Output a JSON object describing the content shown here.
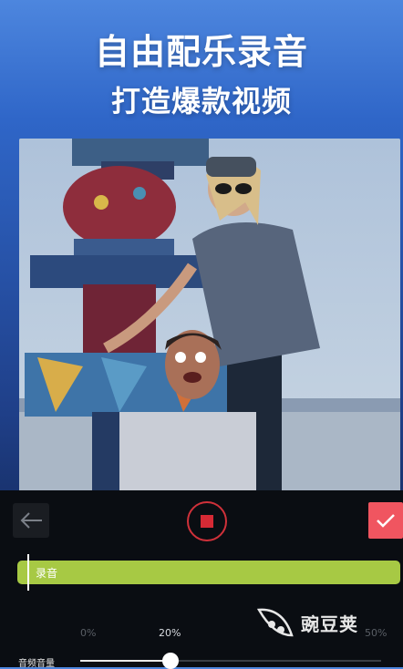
{
  "promo": {
    "title": "自由配乐录音",
    "subtitle": "打造爆款视频"
  },
  "editor": {
    "track_label": "录音",
    "presets": [
      "0%",
      "20%",
      "50%"
    ],
    "active_preset": "20%",
    "volume_label": "音频音量",
    "volume_level": 0.3,
    "icons": {
      "back": "back-arrow-icon",
      "record": "stop-record-icon",
      "confirm": "checkmark-icon"
    }
  },
  "watermark": {
    "brand": "豌豆荚"
  },
  "colors": {
    "track": "#a7c944",
    "record": "#d62a35",
    "confirm": "#f05560",
    "panel": "#0a0d12"
  }
}
